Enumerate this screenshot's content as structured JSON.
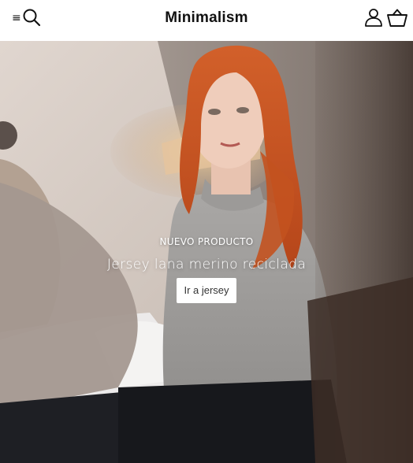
{
  "header": {
    "brand": "Minimalism",
    "icons": {
      "menu": "menu-icon",
      "search": "search-icon",
      "account": "account-icon",
      "cart": "cart-icon"
    }
  },
  "hero": {
    "eyebrow": "NUEVO PRODUCTO",
    "title": "Jersey lana merino reciclada",
    "cta_label": "Ir a jersey"
  },
  "colors": {
    "header_bg": "#ffffff",
    "text": "#111111",
    "hero_text": "#ffffff",
    "hair": "#c4531f",
    "sweater": "#9a9a98"
  }
}
